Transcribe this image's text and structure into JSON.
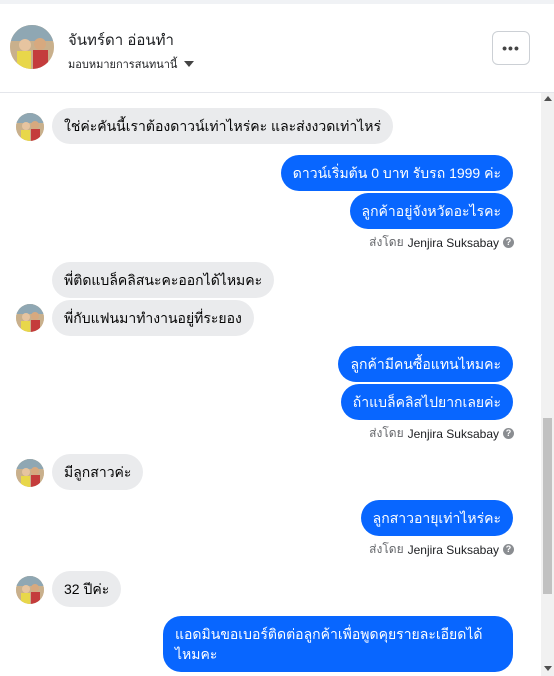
{
  "header": {
    "name": "จันทร์ดา อ่อนทำ",
    "assign_label": "มอบหมายการสนทนานี้",
    "more_label": "•••"
  },
  "messages": [
    {
      "side": "in",
      "text": "ใช่ค่ะคันนี้เราต้องดาวน์เท่าไหร่คะ และส่งงวดเท่าไหร่"
    },
    {
      "side": "out",
      "text": "ดาวน์เริ่มต้น 0 บาท รับรถ 1999 ค่ะ"
    },
    {
      "side": "out",
      "text": "ลูกค้าอยู่จังหวัดอะไรคะ"
    },
    {
      "side": "in",
      "text": "พี่ติดแบล็คลิสนะคะออกได้ไหมคะ"
    },
    {
      "side": "in",
      "text": "พี่กับแฟนมาทำงานอยู่ที่ระยอง"
    },
    {
      "side": "out",
      "text": "ลูกค้ามีคนซื้อแทนไหมคะ"
    },
    {
      "side": "out",
      "text": "ถ้าแบล็คลิสไปยากเลยค่ะ"
    },
    {
      "side": "in",
      "text": "มีลูกสาวค่ะ"
    },
    {
      "side": "out",
      "text": "ลูกสาวอายุเท่าไหร่คะ"
    },
    {
      "side": "in",
      "text": "32 ปีค่ะ"
    },
    {
      "side": "out",
      "text": "แอดมินขอเบอร์ติดต่อลูกค้าเพื่อพูดคุยรายละเอียดได้ไหมคะ"
    }
  ],
  "sent_by": {
    "prefix": "ส่งโดย",
    "name": "Jenjira Suksabay",
    "help_icon": "?"
  },
  "colors": {
    "outgoing_bubble": "#0866ff",
    "incoming_bubble": "#eaebed"
  }
}
